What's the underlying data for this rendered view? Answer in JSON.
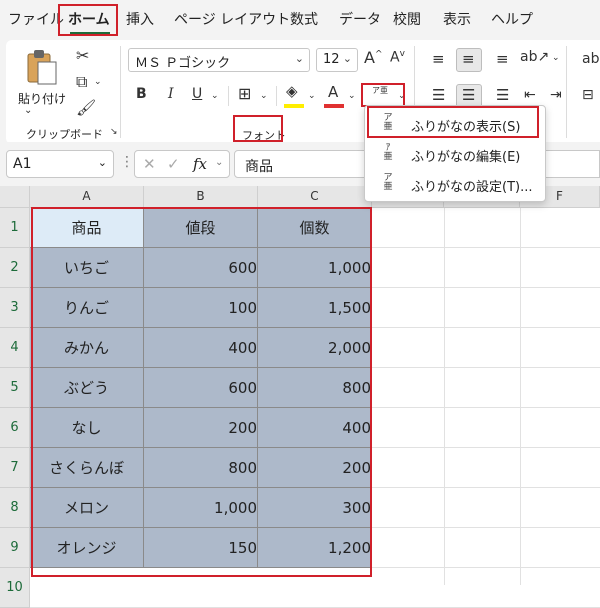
{
  "menu": {
    "tabs": [
      "ファイル",
      "ホーム",
      "挿入",
      "ページ レイアウト",
      "数式",
      "データ",
      "校閲",
      "表示",
      "ヘルプ"
    ],
    "active": "ホーム"
  },
  "ribbon": {
    "clipboard": {
      "paste_label": "貼り付け",
      "group_label": "クリップボード"
    },
    "font": {
      "font_name": "ＭＳ Ｐゴシック",
      "font_size": "12",
      "bold": "B",
      "italic": "I",
      "underline": "U",
      "font_color_glyph": "A",
      "grow_glyph": "A",
      "shrink_glyph": "A",
      "group_label": "フォント",
      "highlight_color": "#ffee00",
      "font_color": "#e03131"
    },
    "phonetic_button_glyph": "ア亜"
  },
  "dropdown": {
    "items": [
      {
        "icon_top": "ア",
        "icon_bottom": "亜",
        "label": "ふりがなの表示(S)"
      },
      {
        "icon_top": "ｱ",
        "icon_bottom": "亜",
        "label": "ふりがなの編集(E)"
      },
      {
        "icon_top": "ア",
        "icon_bottom": "亜",
        "label": "ふりがなの設定(T)..."
      }
    ]
  },
  "formula_bar": {
    "name_box": "A1",
    "fx": "fx",
    "content": "商品"
  },
  "grid": {
    "columns": [
      "A",
      "B",
      "C",
      "D",
      "E",
      "F"
    ],
    "rows": [
      "1",
      "2",
      "3",
      "4",
      "5",
      "6",
      "7",
      "8",
      "9",
      "10"
    ],
    "headers": [
      "商品",
      "値段",
      "個数"
    ],
    "data": [
      [
        "いちご",
        "600",
        "1,000"
      ],
      [
        "りんご",
        "100",
        "1,500"
      ],
      [
        "みかん",
        "400",
        "2,000"
      ],
      [
        "ぶどう",
        "600",
        "800"
      ],
      [
        "なし",
        "200",
        "400"
      ],
      [
        "さくらんぼ",
        "800",
        "200"
      ],
      [
        "メロン",
        "1,000",
        "300"
      ],
      [
        "オレンジ",
        "150",
        "1,200"
      ]
    ]
  },
  "colors": {
    "accent_green": "#1e6b3a",
    "highlight_red": "#d0202a",
    "table_fill": "#adb9ca",
    "selected_cell": "#ddebf7"
  }
}
